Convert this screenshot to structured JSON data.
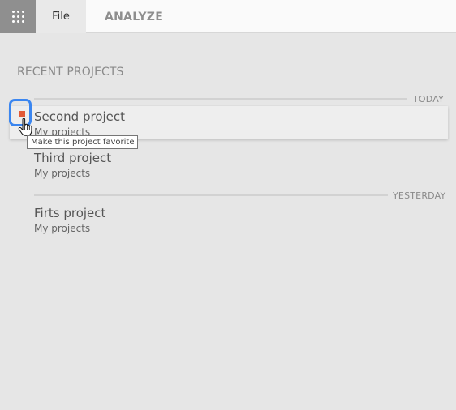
{
  "topbar": {
    "apps_icon": "apps-grid-icon",
    "tabs": [
      {
        "label": "File"
      },
      {
        "label": "ANALYZE"
      }
    ]
  },
  "recent": {
    "title": "RECENT PROJECTS",
    "groups": [
      {
        "date": "TODAY",
        "projects": [
          {
            "name": "Second project",
            "folder": "My projects"
          },
          {
            "name": "Third project",
            "folder": "My projects"
          }
        ]
      },
      {
        "date": "YESTERDAY",
        "projects": [
          {
            "name": "Firts project",
            "folder": "My projects"
          }
        ]
      }
    ]
  },
  "tooltip": {
    "text": "Make this project favorite"
  },
  "colors": {
    "background": "#e6e6e6",
    "focus_ring": "#3b86f0",
    "favorite_marker": "#e25a38",
    "apps_button": "#8f8f8f"
  }
}
